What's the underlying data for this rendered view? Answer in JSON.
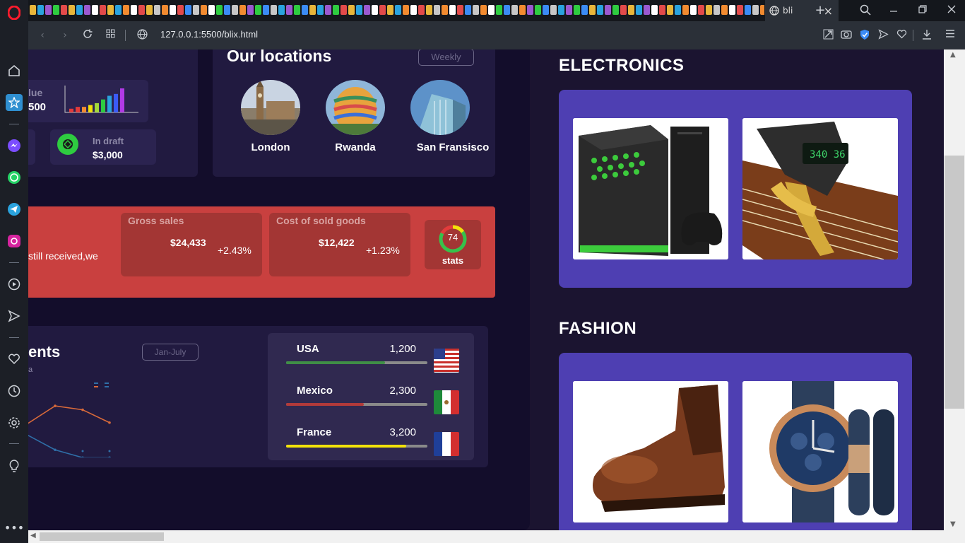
{
  "browser": {
    "url": "127.0.0.1:5500/blix.html",
    "active_tab_title": "bli",
    "tab_close": "×",
    "new_tab": "+"
  },
  "sidebar": {
    "icons": [
      "opera-logo",
      "home-icon",
      "bookmark-icon",
      "messenger-icon",
      "whatsapp-icon",
      "telegram-icon",
      "instagram-icon",
      "player-icon",
      "send-icon",
      "heart-icon",
      "history-icon",
      "settings-icon",
      "lightbulb-icon",
      "more-icon"
    ]
  },
  "dashboard": {
    "value_card": {
      "label": "lue",
      "value": "500"
    },
    "draft_card": {
      "label": "In draft",
      "value": "$3,000"
    },
    "mini_bars": [
      2,
      3,
      3,
      4,
      5,
      7,
      9,
      10,
      13
    ],
    "locations": {
      "title": "Our locations",
      "filter": "Weekly",
      "items": [
        {
          "name": "London"
        },
        {
          "name": "Rwanda"
        },
        {
          "name": "San Fransisco"
        }
      ]
    },
    "alert": {
      "message": "still received,we",
      "gross": {
        "label": "Gross sales",
        "value": "$24,433",
        "change": "+2.43%"
      },
      "cost": {
        "label": "Cost of sold goods",
        "value": "$12,422",
        "change": "+1.23%"
      },
      "stats": {
        "value": "74",
        "label": "stats",
        "fraction": 0.74
      }
    },
    "shipments": {
      "title": "ents",
      "subtitle": "a",
      "filter": "Jan-July",
      "line_a": [
        0.3,
        0.78,
        0.68,
        0.35
      ],
      "line_b": [
        0.05,
        -0.35,
        -0.55,
        -0.55
      ]
    },
    "countries": [
      {
        "name": "USA",
        "value": "1,200",
        "fraction": 0.7,
        "color": "#3f8f46"
      },
      {
        "name": "Mexico",
        "value": "2,300",
        "fraction": 0.55,
        "color": "#b23a3a"
      },
      {
        "name": "France",
        "value": "3,200",
        "fraction": 0.85,
        "color": "#f2e20a"
      }
    ]
  },
  "shop": {
    "sections": [
      {
        "title": "ELECTRONICS",
        "products": [
          "xbox-console-image",
          "guitar-tuner-image"
        ]
      },
      {
        "title": "FASHION",
        "products": [
          "leather-boot-image",
          "wristwatch-image"
        ]
      }
    ]
  },
  "colors": {
    "panel_bg": "#130d2b",
    "card_bg": "#211a40",
    "alert_red": "#c9403f",
    "product_purple": "#4e3fb2"
  }
}
